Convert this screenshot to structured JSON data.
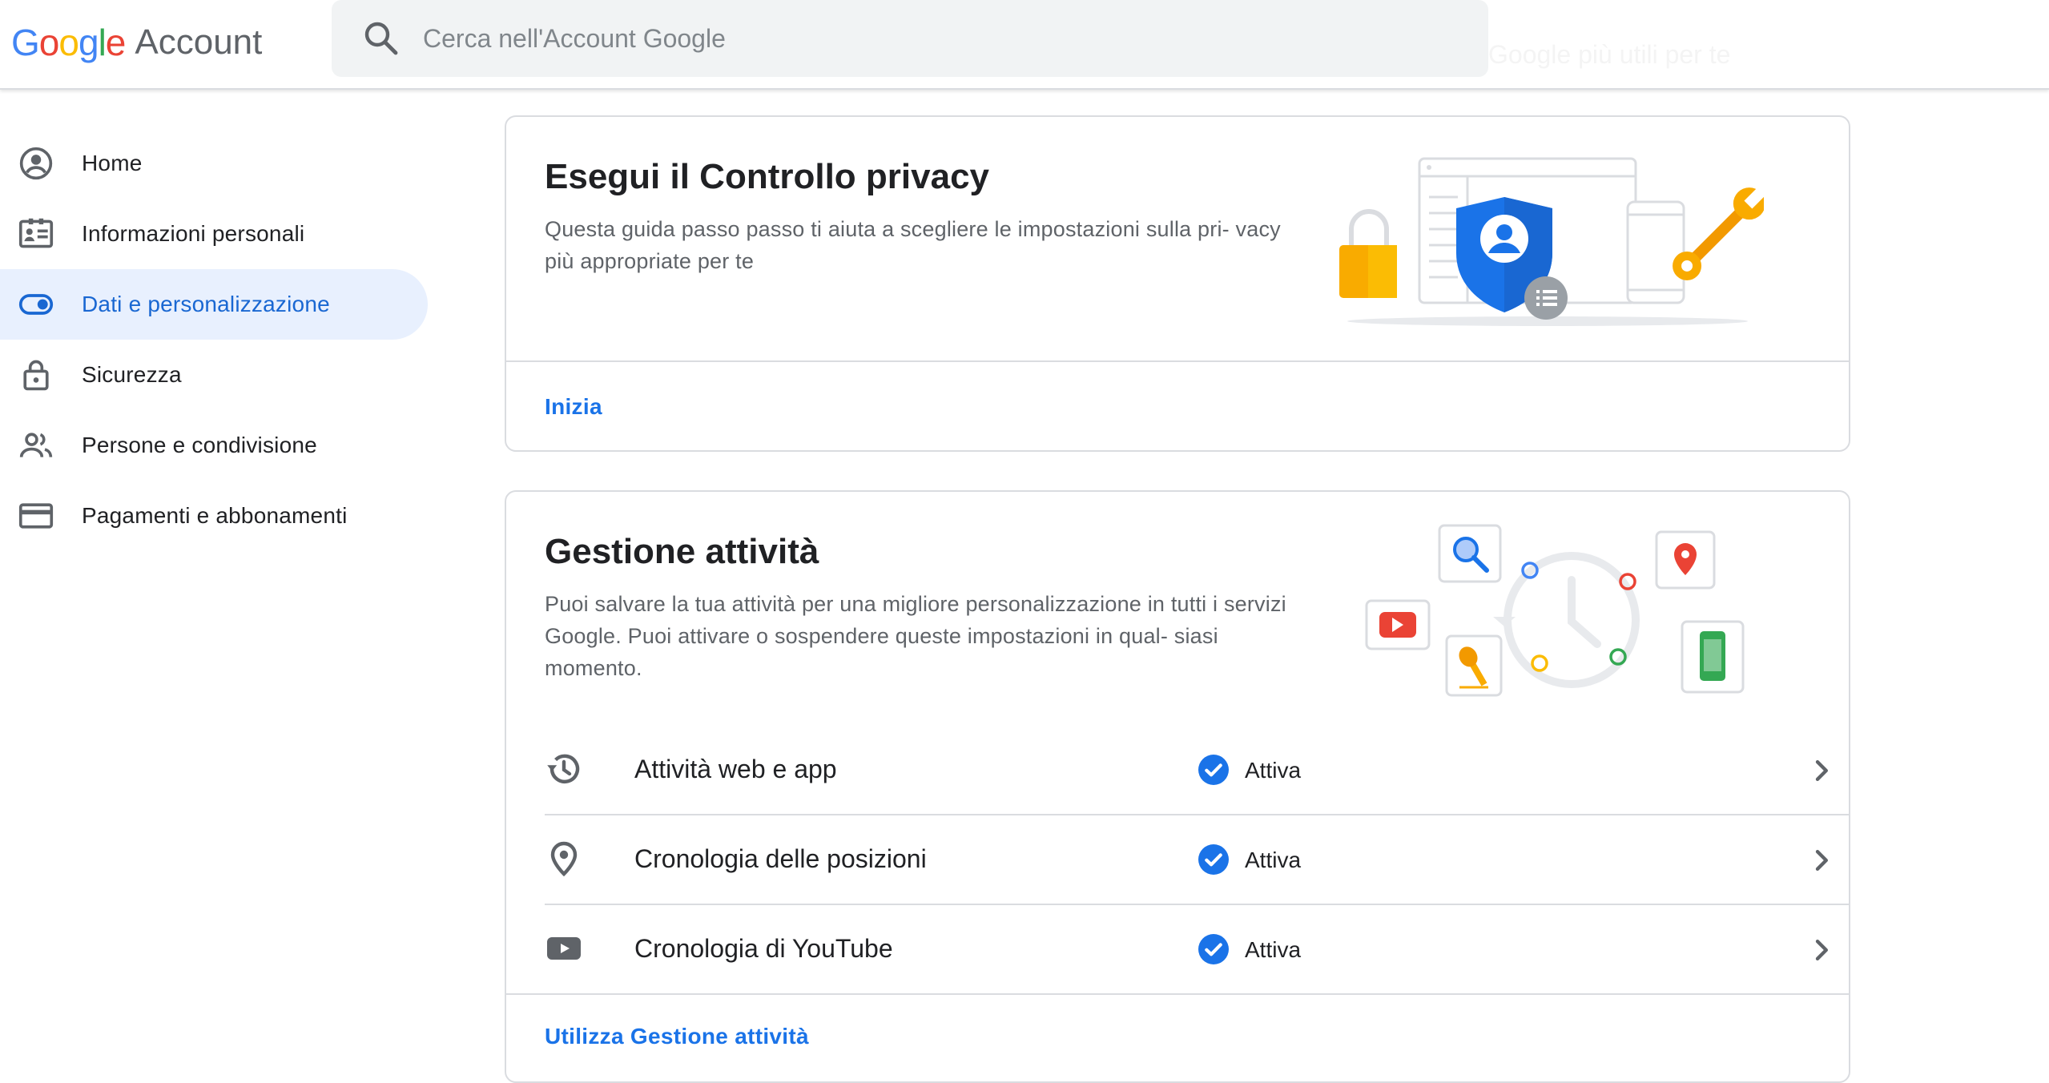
{
  "header": {
    "logo_word": "Google",
    "product": "Account",
    "search_placeholder": "Cerca nell'Account Google",
    "ghost_text": "Google più utili per te"
  },
  "sidebar": {
    "items": [
      {
        "label": "Home",
        "icon": "account-circle-icon",
        "active": false
      },
      {
        "label": "Informazioni personali",
        "icon": "id-card-icon",
        "active": false
      },
      {
        "label": "Dati e personalizzazione",
        "icon": "toggle-icon",
        "active": true
      },
      {
        "label": "Sicurezza",
        "icon": "lock-icon",
        "active": false
      },
      {
        "label": "Persone e condivisione",
        "icon": "people-icon",
        "active": false
      },
      {
        "label": "Pagamenti e abbonamenti",
        "icon": "credit-card-icon",
        "active": false
      }
    ]
  },
  "privacy_card": {
    "title": "Esegui il Controllo privacy",
    "description": "Questa guida passo passo ti aiuta a scegliere le impostazioni sulla pri- vacy più appropriate per te",
    "link": "Inizia"
  },
  "activity_card": {
    "title": "Gestione attività",
    "description": "Puoi salvare la tua attività per una migliore personalizzazione in tutti i servizi Google. Puoi attivare o sospendere queste impostazioni in qual- siasi momento.",
    "rows": [
      {
        "label": "Attività web e app",
        "icon": "history-icon",
        "status": "Attiva"
      },
      {
        "label": "Cronologia delle posizioni",
        "icon": "location-pin-icon",
        "status": "Attiva"
      },
      {
        "label": "Cronologia di YouTube",
        "icon": "youtube-icon",
        "status": "Attiva"
      }
    ],
    "link": "Utilizza Gestione attività"
  },
  "colors": {
    "accent": "#1a73e8",
    "active_bg": "#e8f0fe",
    "divider": "#dadce0",
    "text_secondary": "#5f6368"
  }
}
